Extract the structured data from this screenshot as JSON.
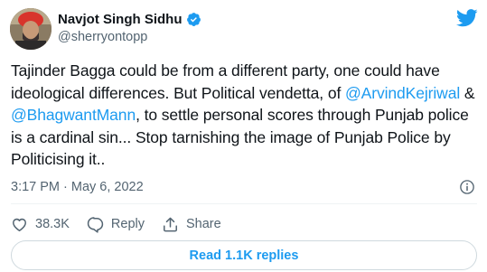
{
  "author": {
    "name": "Navjot Singh Sidhu",
    "handle": "@sherryontopp"
  },
  "tweet": {
    "text_1": "Tajinder Bagga could be from a different party, one could have ideological differences. But Political vendetta, of ",
    "mention_1": "@ArvindKejriwal",
    "text_2": " & ",
    "mention_2": "@BhagwantMann",
    "text_3": ", to settle personal scores through Punjab police is a cardinal sin... Stop tarnishing the image of Punjab Police by Politicising it..",
    "timestamp": "3:17 PM · May 6, 2022"
  },
  "actions": {
    "like_count": "38.3K",
    "reply_label": "Reply",
    "share_label": "Share"
  },
  "read_replies": "Read 1.1K replies",
  "colors": {
    "accent": "#1d9bf0",
    "text": "#0f1419",
    "muted": "#536471"
  },
  "icons": [
    "verified-badge-icon",
    "twitter-bird-icon",
    "info-icon",
    "heart-icon",
    "reply-icon",
    "share-icon"
  ]
}
